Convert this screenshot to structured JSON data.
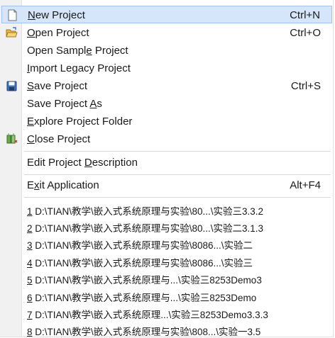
{
  "menu": {
    "items": [
      {
        "label": "New Project",
        "mn": 0,
        "shortcut": "Ctrl+N",
        "icon": "new-document-icon",
        "highlighted": true
      },
      {
        "label": "Open Project",
        "mn": 0,
        "shortcut": "Ctrl+O",
        "icon": "open-folder-icon"
      },
      {
        "label": "Open Sample Project",
        "mn": 10,
        "shortcut": ""
      },
      {
        "label": "Import Legacy Project",
        "mn": 0,
        "shortcut": ""
      },
      {
        "label": "Save Project",
        "mn": 0,
        "shortcut": "Ctrl+S",
        "icon": "save-disk-icon"
      },
      {
        "label": "Save Project As",
        "mn": 13,
        "shortcut": ""
      },
      {
        "label": "Explore Project Folder",
        "mn": 0,
        "shortcut": ""
      },
      {
        "label": "Close Project",
        "mn": 0,
        "shortcut": "",
        "icon": "close-project-icon"
      }
    ],
    "edit_desc": {
      "label": "Edit Project Description",
      "mn": 13
    },
    "exit": {
      "label": "Exit Application",
      "mn": 1,
      "shortcut": "Alt+F4"
    },
    "recent": [
      {
        "num": "1",
        "path": " D:\\TIAN\\教学\\嵌入式系统原理与实验\\80...\\实验三3.3.2"
      },
      {
        "num": "2",
        "path": " D:\\TIAN\\教学\\嵌入式系统原理与实验\\80...\\实验二3.1.3"
      },
      {
        "num": "3",
        "path": " D:\\TIAN\\教学\\嵌入式系统原理与实验\\8086...\\实验二"
      },
      {
        "num": "4",
        "path": " D:\\TIAN\\教学\\嵌入式系统原理与实验\\8086...\\实验三"
      },
      {
        "num": "5",
        "path": " D:\\TIAN\\教学\\嵌入式系统原理与...\\实验三8253Demo3"
      },
      {
        "num": "6",
        "path": " D:\\TIAN\\教学\\嵌入式系统原理与...\\实验三8253Demo"
      },
      {
        "num": "7",
        "path": " D:\\TIAN\\教学\\嵌入式系统原理...\\实验三8253Demo3.3.3"
      },
      {
        "num": "8",
        "path": " D:\\TIAN\\教学\\嵌入式系统原理与实验\\808...\\实验一3.5"
      }
    ]
  }
}
